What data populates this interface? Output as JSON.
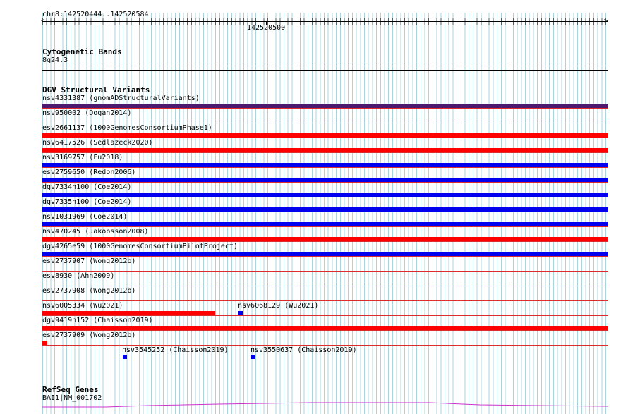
{
  "ruler": {
    "range_label": "chr8:142520444..142520584",
    "position_label": "142520500"
  },
  "cytobands": {
    "title": "Cytogenetic Bands",
    "band": "8q24.3"
  },
  "dgv": {
    "title": "DGV Structural Variants",
    "colors": {
      "purple": "#4b1a6e",
      "red": "#ff0000",
      "blue": "#0000ee",
      "divider": "#dc2c2c"
    },
    "variants": [
      {
        "label": "nsv4331387 (gnomADStructuralVariants)",
        "color": "purple"
      },
      {
        "label": "nsv950002 (Dogan2014)",
        "color": ""
      },
      {
        "label": "esv2661137 (1000GenomesConsortiumPhase1)",
        "color": "red"
      },
      {
        "label": "nsv6417526 (Sedlazeck2020)",
        "color": "red"
      },
      {
        "label": "nsv3169757 (Fu2018)",
        "color": "blue"
      },
      {
        "label": "esv2759650 (Redon2006)",
        "color": "blue"
      },
      {
        "label": "dgv7334n100 (Coe2014)",
        "color": "blue"
      },
      {
        "label": "dgv7335n100 (Coe2014)",
        "color": "blue"
      },
      {
        "label": "nsv1031969 (Coe2014)",
        "color": "blue"
      },
      {
        "label": "nsv470245 (Jakobsson2008)",
        "color": "red"
      },
      {
        "label": "dgv4265e59 (1000GenomesConsortiumPilotProject)",
        "color": "blue"
      },
      {
        "label": "esv2737907 (Wong2012b)",
        "color": ""
      },
      {
        "label": "esv8930 (Ahn2009)",
        "color": ""
      },
      {
        "label": "esv2737908 (Wong2012b)",
        "color": ""
      },
      {
        "label": "nsv6005334 (Wu2021)",
        "color": "red",
        "extent": "partial"
      },
      {
        "label": "dgv9419n152 (Chaisson2019)",
        "color": "red"
      },
      {
        "label": "esv2737909 (Wong2012b)",
        "color": "red",
        "extent": "tiny"
      }
    ],
    "side_features": [
      {
        "label": "nsv6068129 (Wu2021)",
        "color": "blue"
      },
      {
        "label": "nsv3545252 (Chaisson2019)",
        "color": "blue"
      },
      {
        "label": "nsv3550637 (Chaisson2019)",
        "color": "blue"
      }
    ]
  },
  "refseq": {
    "title": "RefSeq Genes",
    "gene": "BAI1|NM_001702",
    "color": "#cc33cc"
  }
}
